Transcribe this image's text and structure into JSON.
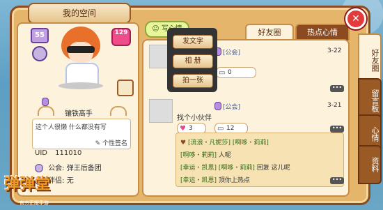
{
  "panel": {
    "title": "我的空间",
    "level_badge": "55",
    "wl_badge": "129",
    "nickname": "镶铁高手",
    "signature": "这个人很懒 什么都没有写",
    "sign_edit": "个性签名",
    "uid_label": "UID",
    "uid_value": "111010",
    "guild_label": "公会:",
    "guild_value": "弹王后备团",
    "partner_label": "伴侣:",
    "partner_value": "无"
  },
  "header": {
    "write_label": "写心情",
    "tabs": [
      {
        "label": "好友圈",
        "active": true
      },
      {
        "label": "热点心情",
        "active": false
      }
    ],
    "close": "✕"
  },
  "side_tabs": [
    {
      "label": "好友圈",
      "active": true
    },
    {
      "label": "留言板",
      "active": false
    },
    {
      "label": "心情",
      "active": false
    },
    {
      "label": "资料",
      "active": false
    }
  ],
  "popup": {
    "items": [
      "发文字",
      "相 册",
      "拍一张"
    ]
  },
  "posts": [
    {
      "tag": "[公会]",
      "date": "3-22",
      "likes": "0",
      "text": "",
      "more": "•••"
    },
    {
      "tag": "[公会]",
      "date": "3-21",
      "text": "找个小伙伴",
      "likes": "3",
      "comments": "12",
      "more": "•••"
    }
  ],
  "comments": [
    {
      "name": "[流浪・凡妮莎]",
      "reply": "[啊哆・莉莉]",
      "text": ""
    },
    {
      "name": "[啊哆・莉莉]",
      "reply": "",
      "text": "人呢"
    },
    {
      "name": "[幸运・凯恩]",
      "reply": "[啊哆・莉莉]",
      "text": "回复 这儿呢"
    },
    {
      "name": "[幸运・凯恩]",
      "reply": "",
      "text": "顶你上热点"
    }
  ],
  "logo": {
    "title": "弹弹堂",
    "subtitle": "官方正版手游"
  }
}
